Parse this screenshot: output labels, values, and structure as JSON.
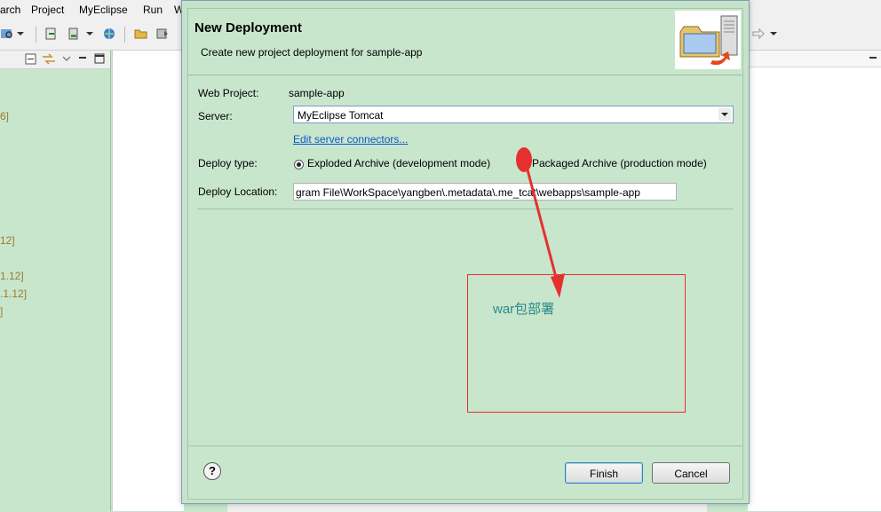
{
  "menubar": {
    "items": [
      "arch",
      "Project",
      "MyEclipse",
      "Run",
      "W"
    ]
  },
  "left_panel": {
    "fragments": [
      "6]",
      "12]",
      "1.12]",
      ".1.12]",
      "]"
    ]
  },
  "dialog": {
    "title": "New Deployment",
    "description": "Create new project deployment for sample-app",
    "web_project_label": "Web Project:",
    "web_project_value": "sample-app",
    "server_label": "Server:",
    "server_value": "MyEclipse Tomcat",
    "edit_link": "Edit server connectors...",
    "deploy_type_label": "Deploy type:",
    "deploy_options": [
      {
        "label": "Exploded Archive (development mode)",
        "selected": true
      },
      {
        "label": "Packaged Archive (production mode)",
        "selected": false
      }
    ],
    "deploy_location_label": "Deploy Location:",
    "deploy_location_value": "gram File\\WorkSpace\\yangben\\.metadata\\.me_tcat\\webapps\\sample-app",
    "help_glyph": "?",
    "finish_label": "Finish",
    "cancel_label": "Cancel"
  },
  "annotation": {
    "text": "war包部署",
    "color": "#e53030"
  },
  "colors": {
    "panel_bg": "#c8e6cc",
    "link": "#0b57c8",
    "annotation_text": "#2a8a8a"
  }
}
